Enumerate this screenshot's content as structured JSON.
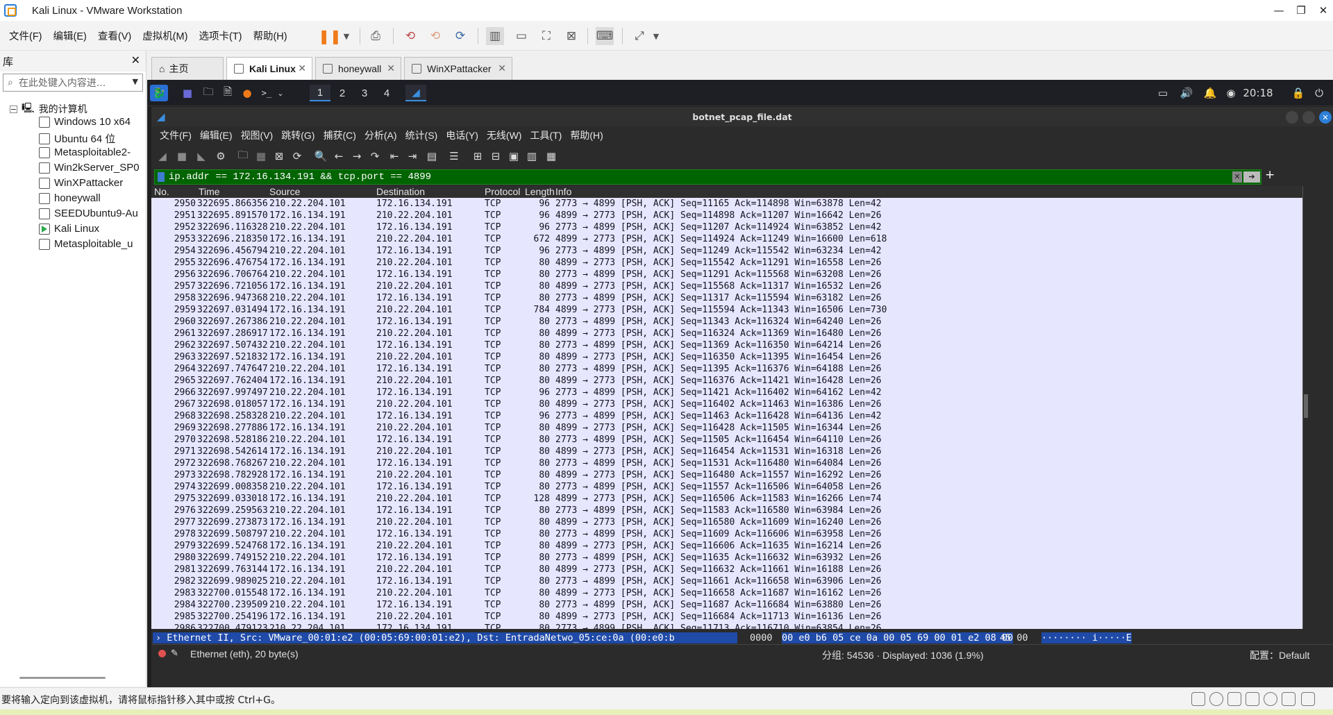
{
  "window": {
    "title": "Kali Linux - VMware Workstation"
  },
  "menubar": [
    "文件(F)",
    "编辑(E)",
    "查看(V)",
    "虚拟机(M)",
    "选项卡(T)",
    "帮助(H)"
  ],
  "library": {
    "title": "库",
    "search_placeholder": "在此处键入内容进...",
    "root": "我的计算机",
    "items": [
      "Windows 10 x64",
      "Ubuntu 64 位",
      "Metasploitable2-",
      "Win2kServer_SP0",
      "WinXPattacker",
      "honeywall",
      "SEEDUbuntu9-Au",
      "Kali Linux",
      "Metasploitable_u"
    ]
  },
  "vm_tabs": [
    {
      "label": "主页"
    },
    {
      "label": "Kali Linux"
    },
    {
      "label": "honeywall"
    },
    {
      "label": "WinXPattacker"
    }
  ],
  "kali_panel": {
    "workspaces": [
      "1",
      "2",
      "3",
      "4"
    ],
    "clock": "20:18"
  },
  "wireshark": {
    "title": "botnet_pcap_file.dat",
    "menu": [
      "文件(F)",
      "编辑(E)",
      "视图(V)",
      "跳转(G)",
      "捕获(C)",
      "分析(A)",
      "统计(S)",
      "电话(Y)",
      "无线(W)",
      "工具(T)",
      "帮助(H)"
    ],
    "filter": "ip.addr == 172.16.134.191 && tcp.port == 4899",
    "columns": [
      "No.",
      "Time",
      "Source",
      "Destination",
      "Protocol",
      "Length",
      "Info"
    ],
    "rows": [
      [
        "2950",
        "322695.866356",
        "210.22.204.101",
        "172.16.134.191",
        "TCP",
        "96",
        "2773 → 4899 [PSH, ACK] Seq=11165 Ack=114898 Win=63878 Len=42"
      ],
      [
        "2951",
        "322695.891570",
        "172.16.134.191",
        "210.22.204.101",
        "TCP",
        "96",
        "4899 → 2773 [PSH, ACK] Seq=114898 Ack=11207 Win=16642 Len=26"
      ],
      [
        "2952",
        "322696.116328",
        "210.22.204.101",
        "172.16.134.191",
        "TCP",
        "96",
        "2773 → 4899 [PSH, ACK] Seq=11207 Ack=114924 Win=63852 Len=42"
      ],
      [
        "2953",
        "322696.218350",
        "172.16.134.191",
        "210.22.204.101",
        "TCP",
        "672",
        "4899 → 2773 [PSH, ACK] Seq=114924 Ack=11249 Win=16600 Len=618"
      ],
      [
        "2954",
        "322696.456794",
        "210.22.204.101",
        "172.16.134.191",
        "TCP",
        "96",
        "2773 → 4899 [PSH, ACK] Seq=11249 Ack=115542 Win=63234 Len=42"
      ],
      [
        "2955",
        "322696.476754",
        "172.16.134.191",
        "210.22.204.101",
        "TCP",
        "80",
        "4899 → 2773 [PSH, ACK] Seq=115542 Ack=11291 Win=16558 Len=26"
      ],
      [
        "2956",
        "322696.706764",
        "210.22.204.101",
        "172.16.134.191",
        "TCP",
        "80",
        "2773 → 4899 [PSH, ACK] Seq=11291 Ack=115568 Win=63208 Len=26"
      ],
      [
        "2957",
        "322696.721056",
        "172.16.134.191",
        "210.22.204.101",
        "TCP",
        "80",
        "4899 → 2773 [PSH, ACK] Seq=115568 Ack=11317 Win=16532 Len=26"
      ],
      [
        "2958",
        "322696.947368",
        "210.22.204.101",
        "172.16.134.191",
        "TCP",
        "80",
        "2773 → 4899 [PSH, ACK] Seq=11317 Ack=115594 Win=63182 Len=26"
      ],
      [
        "2959",
        "322697.031494",
        "172.16.134.191",
        "210.22.204.101",
        "TCP",
        "784",
        "4899 → 2773 [PSH, ACK] Seq=115594 Ack=11343 Win=16506 Len=730"
      ],
      [
        "2960",
        "322697.267386",
        "210.22.204.101",
        "172.16.134.191",
        "TCP",
        "80",
        "2773 → 4899 [PSH, ACK] Seq=11343 Ack=116324 Win=64240 Len=26"
      ],
      [
        "2961",
        "322697.286917",
        "172.16.134.191",
        "210.22.204.101",
        "TCP",
        "80",
        "4899 → 2773 [PSH, ACK] Seq=116324 Ack=11369 Win=16480 Len=26"
      ],
      [
        "2962",
        "322697.507432",
        "210.22.204.101",
        "172.16.134.191",
        "TCP",
        "80",
        "2773 → 4899 [PSH, ACK] Seq=11369 Ack=116350 Win=64214 Len=26"
      ],
      [
        "2963",
        "322697.521832",
        "172.16.134.191",
        "210.22.204.101",
        "TCP",
        "80",
        "4899 → 2773 [PSH, ACK] Seq=116350 Ack=11395 Win=16454 Len=26"
      ],
      [
        "2964",
        "322697.747647",
        "210.22.204.101",
        "172.16.134.191",
        "TCP",
        "80",
        "2773 → 4899 [PSH, ACK] Seq=11395 Ack=116376 Win=64188 Len=26"
      ],
      [
        "2965",
        "322697.762404",
        "172.16.134.191",
        "210.22.204.101",
        "TCP",
        "80",
        "4899 → 2773 [PSH, ACK] Seq=116376 Ack=11421 Win=16428 Len=26"
      ],
      [
        "2966",
        "322697.997497",
        "210.22.204.101",
        "172.16.134.191",
        "TCP",
        "96",
        "2773 → 4899 [PSH, ACK] Seq=11421 Ack=116402 Win=64162 Len=42"
      ],
      [
        "2967",
        "322698.018057",
        "172.16.134.191",
        "210.22.204.101",
        "TCP",
        "80",
        "4899 → 2773 [PSH, ACK] Seq=116402 Ack=11463 Win=16386 Len=26"
      ],
      [
        "2968",
        "322698.258328",
        "210.22.204.101",
        "172.16.134.191",
        "TCP",
        "96",
        "2773 → 4899 [PSH, ACK] Seq=11463 Ack=116428 Win=64136 Len=42"
      ],
      [
        "2969",
        "322698.277886",
        "172.16.134.191",
        "210.22.204.101",
        "TCP",
        "80",
        "4899 → 2773 [PSH, ACK] Seq=116428 Ack=11505 Win=16344 Len=26"
      ],
      [
        "2970",
        "322698.528186",
        "210.22.204.101",
        "172.16.134.191",
        "TCP",
        "80",
        "2773 → 4899 [PSH, ACK] Seq=11505 Ack=116454 Win=64110 Len=26"
      ],
      [
        "2971",
        "322698.542614",
        "172.16.134.191",
        "210.22.204.101",
        "TCP",
        "80",
        "4899 → 2773 [PSH, ACK] Seq=116454 Ack=11531 Win=16318 Len=26"
      ],
      [
        "2972",
        "322698.768267",
        "210.22.204.101",
        "172.16.134.191",
        "TCP",
        "80",
        "2773 → 4899 [PSH, ACK] Seq=11531 Ack=116480 Win=64084 Len=26"
      ],
      [
        "2973",
        "322698.782928",
        "172.16.134.191",
        "210.22.204.101",
        "TCP",
        "80",
        "4899 → 2773 [PSH, ACK] Seq=116480 Ack=11557 Win=16292 Len=26"
      ],
      [
        "2974",
        "322699.008358",
        "210.22.204.101",
        "172.16.134.191",
        "TCP",
        "80",
        "2773 → 4899 [PSH, ACK] Seq=11557 Ack=116506 Win=64058 Len=26"
      ],
      [
        "2975",
        "322699.033018",
        "172.16.134.191",
        "210.22.204.101",
        "TCP",
        "128",
        "4899 → 2773 [PSH, ACK] Seq=116506 Ack=11583 Win=16266 Len=74"
      ],
      [
        "2976",
        "322699.259563",
        "210.22.204.101",
        "172.16.134.191",
        "TCP",
        "80",
        "2773 → 4899 [PSH, ACK] Seq=11583 Ack=116580 Win=63984 Len=26"
      ],
      [
        "2977",
        "322699.273873",
        "172.16.134.191",
        "210.22.204.101",
        "TCP",
        "80",
        "4899 → 2773 [PSH, ACK] Seq=116580 Ack=11609 Win=16240 Len=26"
      ],
      [
        "2978",
        "322699.508797",
        "210.22.204.101",
        "172.16.134.191",
        "TCP",
        "80",
        "2773 → 4899 [PSH, ACK] Seq=11609 Ack=116606 Win=63958 Len=26"
      ],
      [
        "2979",
        "322699.524768",
        "172.16.134.191",
        "210.22.204.101",
        "TCP",
        "80",
        "4899 → 2773 [PSH, ACK] Seq=116606 Ack=11635 Win=16214 Len=26"
      ],
      [
        "2980",
        "322699.749152",
        "210.22.204.101",
        "172.16.134.191",
        "TCP",
        "80",
        "2773 → 4899 [PSH, ACK] Seq=11635 Ack=116632 Win=63932 Len=26"
      ],
      [
        "2981",
        "322699.763144",
        "172.16.134.191",
        "210.22.204.101",
        "TCP",
        "80",
        "4899 → 2773 [PSH, ACK] Seq=116632 Ack=11661 Win=16188 Len=26"
      ],
      [
        "2982",
        "322699.989025",
        "210.22.204.101",
        "172.16.134.191",
        "TCP",
        "80",
        "2773 → 4899 [PSH, ACK] Seq=11661 Ack=116658 Win=63906 Len=26"
      ],
      [
        "2983",
        "322700.015548",
        "172.16.134.191",
        "210.22.204.101",
        "TCP",
        "80",
        "4899 → 2773 [PSH, ACK] Seq=116658 Ack=11687 Win=16162 Len=26"
      ],
      [
        "2984",
        "322700.239509",
        "210.22.204.101",
        "172.16.134.191",
        "TCP",
        "80",
        "2773 → 4899 [PSH, ACK] Seq=11687 Ack=116684 Win=63880 Len=26"
      ],
      [
        "2985",
        "322700.254196",
        "172.16.134.191",
        "210.22.204.101",
        "TCP",
        "80",
        "4899 → 2773 [PSH, ACK] Seq=116684 Ack=11713 Win=16136 Len=26"
      ],
      [
        "2986",
        "322700.479123",
        "210.22.204.101",
        "172.16.134.191",
        "TCP",
        "80",
        "2773 → 4899 [PSH, ACK] Seq=11713 Ack=116710 Win=63854 Len=26"
      ]
    ],
    "details_line": "› Ethernet II, Src: VMware_00:01:e2 (00:05:69:00:01:e2), Dst: EntradaNetwo_05:ce:0a (00:e0:b",
    "hex": {
      "offset": "0000",
      "bytes_sel": "00 e0 b6 05 ce 0a 00 05  69 00 01 e2 08 00",
      "bytes_rest": "45 00",
      "ascii": "········ i·····E"
    },
    "status": {
      "left": "Ethernet (eth), 20 byte(s)",
      "center": "分组: 54536 · Displayed: 1036 (1.9%)",
      "right": "配置：Default"
    }
  },
  "bottom_hint": "要将输入定向到该虚拟机，请将鼠标指针移入其中或按 Ctrl+G。"
}
